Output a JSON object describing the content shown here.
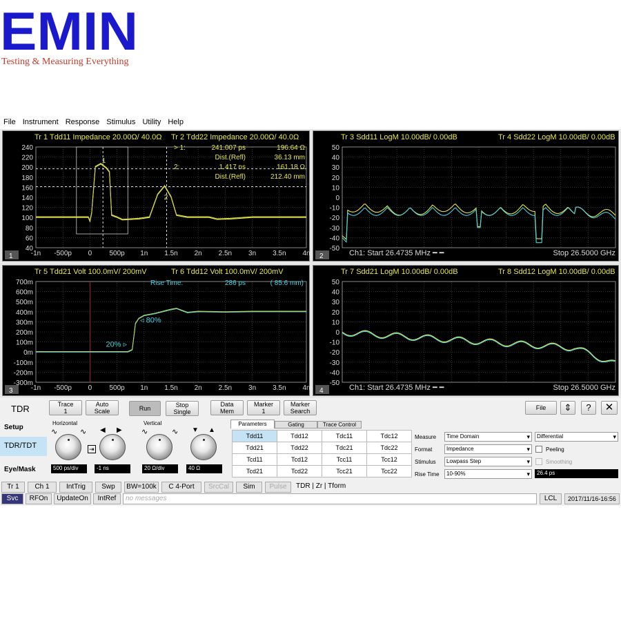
{
  "brand": {
    "logo": "EMIN",
    "tagline": "Testing & Measuring Everything",
    "color": "#1a1acc",
    "tagline_color": "#c23a2b"
  },
  "menu": [
    "File",
    "Instrument",
    "Response",
    "Stimulus",
    "Utility",
    "Help"
  ],
  "panels": [
    {
      "num": "1",
      "header_a": "Tr  1",
      "header_a2": "Tdd11 Impedance 20.00Ω/  40.0Ω",
      "header_b": "Tr  2",
      "header_b2": "Tdd22 Impedance 20.00Ω/  40.0Ω",
      "yticks": [
        "240",
        "220",
        "200",
        "180",
        "160",
        "140",
        "120",
        "100",
        "80",
        "60",
        "40"
      ],
      "xticks": [
        "-1n",
        "-500p",
        "0",
        "500p",
        "1n",
        "1.5n",
        "2n",
        "2.5n",
        "3n",
        "3.5n",
        "4n"
      ],
      "markers": [
        {
          "label": "> 1:",
          "v1": "241.007  ps",
          "v2": "196.64 Ω"
        },
        {
          "label": "",
          "v1": "Dist.(Refl)",
          "v2": "36.13 mm"
        },
        {
          "label": "2:",
          "v1": "1.417  ns",
          "v2": "161.18 Ω"
        },
        {
          "label": "",
          "v1": "Dist.(Refl)",
          "v2": "212.40 mm"
        }
      ],
      "marker_names": [
        "1",
        "2"
      ]
    },
    {
      "num": "2",
      "header_a": "Tr  3",
      "header_a2": "Sdd11 LogM 10.00dB/  0.00dB",
      "header_b": "Tr  4",
      "header_b2": "Sdd22 LogM 10.00dB/  0.00dB",
      "yticks": [
        "50",
        "40",
        "30",
        "20",
        "10",
        "0",
        "-10",
        "-20",
        "-30",
        "-40",
        "-50"
      ],
      "start": "Ch1:  Start  26.4735 MHz",
      "stop": "Stop  26.5000 GHz"
    },
    {
      "num": "3",
      "header_a": "Tr  5",
      "header_a2": "Tdd21 Volt 100.0mV/  200mV",
      "header_b": "Tr  6",
      "header_b2": "Tdd12 Volt 100.0mV/  200mV",
      "yticks": [
        "700m",
        "600m",
        "500m",
        "400m",
        "300m",
        "200m",
        "100m",
        "0m",
        "-100m",
        "-200m",
        "-300m"
      ],
      "xticks": [
        "-1n",
        "-500p",
        "0",
        "500p",
        "1n",
        "1.5n",
        "2n",
        "2.5n",
        "3n",
        "3.5n",
        "4n"
      ],
      "rise_label": "Rise Time:",
      "rise_value": "286 ps",
      "rise_dist": "( 85.6 mm)",
      "pct80": "80%",
      "pct20": "20%"
    },
    {
      "num": "4",
      "header_a": "Tr  7",
      "header_a2": "Sdd21 LogM 10.00dB/  0.00dB",
      "header_b": "Tr  8",
      "header_b2": "Sdd12 LogM 10.00dB/  0.00dB",
      "yticks": [
        "50",
        "40",
        "30",
        "20",
        "10",
        "0",
        "-10",
        "-20",
        "-30",
        "-40",
        "-50"
      ],
      "start": "Ch1:  Start  26.4735 MHz",
      "stop": "Stop  26.5000 GHz"
    }
  ],
  "toolbar": {
    "mode": "TDR",
    "trace": "Trace\n1",
    "autoscale": "Auto\nScale",
    "run": "Run",
    "stop": "Stop\nSingle",
    "datamem": "Data\nMem",
    "marker": "Marker\n1",
    "search": "Marker\nSearch",
    "file": "File"
  },
  "side": {
    "setup": "Setup",
    "tdr": "TDR/TDT",
    "eye": "Eye/Mask"
  },
  "horizontal": {
    "title": "Horizontal",
    "v1": "500 ps/div",
    "v2": "-1 ns"
  },
  "vertical": {
    "title": "Vertical",
    "v1": "20 Ω/div",
    "v2": "40 Ω"
  },
  "tabs": [
    "Parameters",
    "Gating",
    "Trace Control"
  ],
  "params": [
    [
      "Tdd11",
      "Tdd12",
      "Tdc11",
      "Tdc12"
    ],
    [
      "Tdd21",
      "Tdd22",
      "Tdc21",
      "Tdc22"
    ],
    [
      "Tcd11",
      "Tcd12",
      "Tcc11",
      "Tcc12"
    ],
    [
      "Tcd21",
      "Tcd22",
      "Tcc21",
      "Tcc22"
    ]
  ],
  "settings": {
    "measure_l": "Measure",
    "measure": "Time Domain",
    "measure2": "Differential",
    "format_l": "Format",
    "format": "Impedance",
    "peeling": "Peeling",
    "stimulus_l": "Stimulus",
    "stimulus": "Lowpass Step",
    "smoothing": "Smoothing",
    "rise_l": "Rise Time",
    "rise": "10-90%",
    "rise_val": "26.4 ps"
  },
  "status1": [
    "Tr 1",
    "Ch 1",
    "IntTrig",
    "Swp",
    "BW=100k",
    "C  4-Port",
    "SrcCal",
    "Sim",
    "Pulse",
    "TDR | Zr | Tform"
  ],
  "status2": {
    "svc": "Svc",
    "rfon": "RFOn",
    "update": "UpdateOn",
    "intref": "IntRef",
    "msg": "no messages",
    "lcl": "LCL",
    "time": "2017/11/16-16:56"
  },
  "colors": {
    "yellow": "#e8e84a",
    "cyan": "#46d3e0",
    "panel_bg": "#000"
  }
}
